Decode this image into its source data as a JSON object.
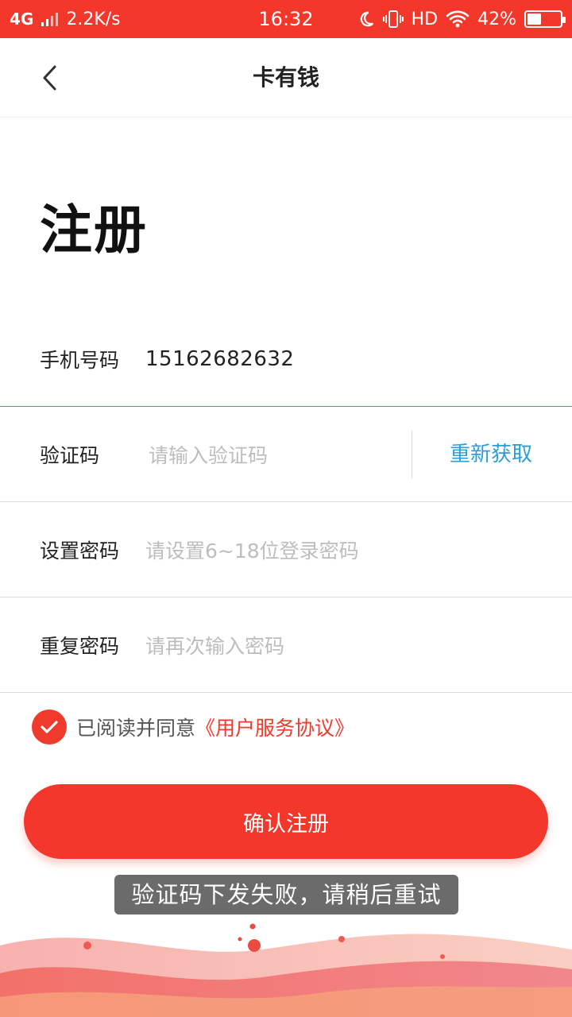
{
  "status_bar": {
    "network": "4G",
    "speed": "2.2K/s",
    "time": "16:32",
    "hd": "HD",
    "battery": "42%",
    "battery_level": 0.42
  },
  "nav": {
    "title": "卡有钱"
  },
  "page": {
    "heading": "注册"
  },
  "form": {
    "phone_label": "手机号码",
    "phone_value": "15162682632",
    "code_label": "验证码",
    "code_placeholder": "请输入验证码",
    "resend_label": "重新获取",
    "password_label": "设置密码",
    "password_placeholder": "请设置6~18位登录密码",
    "repeat_label": "重复密码",
    "repeat_placeholder": "请再次输入密码"
  },
  "agreement": {
    "prefix": "已阅读并同意",
    "link": "《用户服务协议》",
    "checked": true
  },
  "submit": {
    "label": "确认注册"
  },
  "toast": {
    "message": "验证码下发失败，请稍后重试"
  },
  "colors": {
    "brand": "#f3372b",
    "link": "#2a9fd6"
  }
}
